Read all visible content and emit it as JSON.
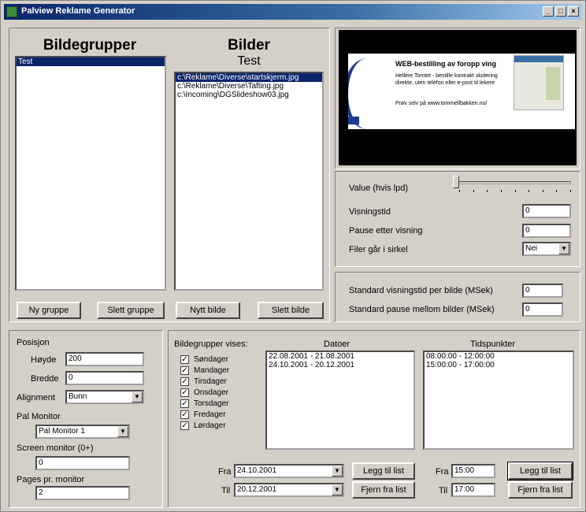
{
  "window": {
    "title": "Palview Reklame Generator",
    "controls": [
      "_",
      "□",
      "×"
    ]
  },
  "groups": {
    "heading": "Bildegrupper",
    "items": [
      "Test"
    ],
    "new_button": "Ny gruppe",
    "delete_button": "Slett gruppe"
  },
  "images": {
    "heading": "Bilder",
    "subheading": "Test",
    "items": [
      "c:\\Reklame\\Diverse\\startskjerm.jpg",
      "c:\\Reklame\\Diverse\\Tafting.jpg",
      "c:\\Incoming\\DGSlideshow03.jpg"
    ],
    "new_button": "Nytt bilde",
    "delete_button": "Slett bilde"
  },
  "preview": {
    "title": "WEB-bestilling av foropp ving",
    "body": "Hellere Tomtet - bestille kontrakt skolering direkte, uten telefon eller e-post til lekere",
    "footer": "Prøv selv på www.tommellbakken.no/"
  },
  "settings": {
    "value_label": "Value (hvis lpd)",
    "value_level": 0,
    "view_time_label": "Visningstid",
    "view_time_value": "0",
    "pause_label": "Pause etter visning",
    "pause_value": "0",
    "loop_label": "Filer går i sirkel",
    "loop_value": "Nei"
  },
  "defaults": {
    "view_time_label": "Standard visningstid per bilde (MSek)",
    "view_time_value": "0",
    "pause_label": "Standard pause mellom bilder (MSek)",
    "pause_value": "0"
  },
  "position": {
    "heading": "Posisjon",
    "height_label": "Høyde",
    "height_value": "200",
    "width_label": "Bredde",
    "width_value": "0",
    "alignment_label": "Alignment",
    "alignment_value": "Bunn",
    "monitor_label": "Pal Monitor",
    "monitor_value": "Pal Monitor 1",
    "screen_label": "Screen monitor (0+)",
    "screen_value": "0",
    "pages_label": "Pages pr. monitor",
    "pages_value": "2"
  },
  "schedule": {
    "groups_label": "Bildegrupper vises:",
    "days": [
      {
        "label": "Søndager",
        "checked": true
      },
      {
        "label": "Mandager",
        "checked": true
      },
      {
        "label": "Tirsdager",
        "checked": true
      },
      {
        "label": "Onsdager",
        "checked": true
      },
      {
        "label": "Torsdager",
        "checked": true
      },
      {
        "label": "Fredager",
        "checked": true
      },
      {
        "label": "Lørdager",
        "checked": true
      }
    ],
    "check_mark": "✓",
    "dates_heading": "Datoer",
    "dates": [
      "22.08.2001 - 21.08.2001",
      "24.10.2001 - 20.12.2001"
    ],
    "times_heading": "Tidspunkter",
    "times": [
      "08:00:00 - 12:00:00",
      "15:00:00 - 17:00:00"
    ],
    "from_label": "Fra",
    "from_date": "24.10.2001",
    "to_label": "Til",
    "to_date": "20.12.2001",
    "add_date_button": "Legg til list",
    "remove_date_button": "Fjern fra list",
    "time_from_label": "Fra",
    "time_from": "15:00",
    "time_to_label": "Til",
    "time_to": "17:00",
    "add_time_button": "Legg til list",
    "remove_time_button": "Fjern fra list"
  }
}
